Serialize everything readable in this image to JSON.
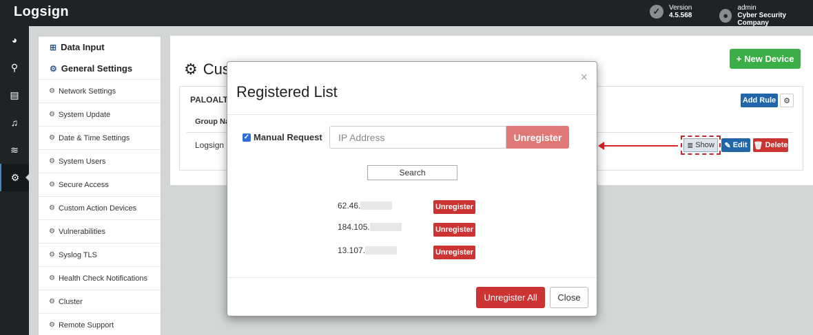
{
  "header": {
    "brand": "Logsign",
    "version_label": "Version",
    "version_value": "4.5.568",
    "user_name": "admin",
    "company": "Cyber Security Company"
  },
  "rail": {
    "icons": [
      "dashboard-icon",
      "search-icon",
      "newspaper-icon",
      "bell-icon",
      "wifi-icon",
      "gear-icon"
    ]
  },
  "menu": {
    "data_input": "Data Input",
    "general_settings": "General Settings",
    "items": [
      "Network Settings",
      "System Update",
      "Date & Time Settings",
      "System Users",
      "Secure Access",
      "Custom Action Devices",
      "Vulnerabilities",
      "Syslog TLS",
      "Health Check Notifications",
      "Cluster",
      "Remote Support"
    ]
  },
  "main": {
    "title_fragment": "Cus",
    "new_device": "New Device",
    "device_name": "PALOALTO",
    "add_rule": "Add Rule",
    "column_group": "Group Na",
    "row_group": "Logsign",
    "show": "Show",
    "edit": "Edit",
    "delete": "Delete"
  },
  "modal": {
    "title": "Registered List",
    "close_x": "×",
    "manual_request": "Manual Request",
    "ip_placeholder": "IP Address",
    "unregister": "Unregister",
    "search": "Search",
    "ips": [
      "62.46.",
      "184.105.",
      "13.107."
    ],
    "row_unregister": "Unregister",
    "unregister_all": "Unregister All",
    "close": "Close"
  },
  "colors": {
    "topbar": "#1f2325",
    "green": "#3cae48",
    "blue": "#2266aa",
    "red": "#cc3333",
    "annotation_red": "#dd2222"
  }
}
